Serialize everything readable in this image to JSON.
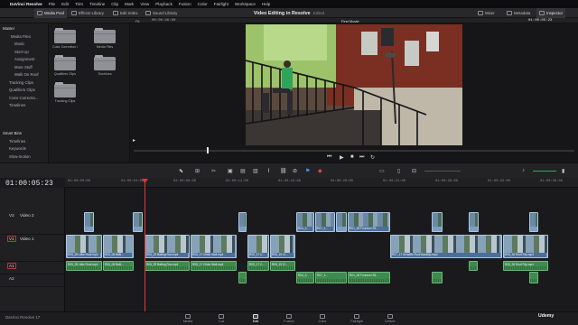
{
  "menubar": {
    "app": "DaVinci Resolve",
    "items": [
      "File",
      "Edit",
      "Trim",
      "Timeline",
      "Clip",
      "Mark",
      "View",
      "Playback",
      "Fusion",
      "Color",
      "Fairlight",
      "Workspace",
      "Help"
    ]
  },
  "toolbar": {
    "left": [
      "Media Pool",
      "Effects Library",
      "Edit Index",
      "Sound Library"
    ],
    "project_title": "Video Editing in Resolve",
    "project_state": "Edited",
    "right": [
      "Mixer",
      "Metadata",
      "Inspector"
    ]
  },
  "viewer": {
    "zoom": "Fit",
    "source_timecode": "00:00:36:00",
    "timeline_name": "First Movie",
    "record_timecode": "01:00:05:23"
  },
  "sidebar": {
    "master_label": "Master",
    "items": [
      {
        "label": "Media Files",
        "level": 1
      },
      {
        "label": "Music",
        "level": 2
      },
      {
        "label": "Stort Up",
        "level": 2
      },
      {
        "label": "Assignment",
        "level": 2
      },
      {
        "label": "More Stuff",
        "level": 2
      },
      {
        "label": "Walk On Roof",
        "level": 2
      },
      {
        "label": "Tracking Clips",
        "level": 1
      },
      {
        "label": "Qualifiers Clips",
        "level": 1
      },
      {
        "label": "Color Correctio...",
        "level": 1
      },
      {
        "label": "Timelines",
        "level": 1
      }
    ],
    "smart_bins_label": "Smart Bins",
    "smart_bins": [
      "Timelines",
      "Keywords",
      "Slow-motion"
    ]
  },
  "bins": [
    {
      "label": "Color Correction C..."
    },
    {
      "label": "Media Files"
    },
    {
      "label": "Qualifiers Clips"
    },
    {
      "label": "Timelines"
    },
    {
      "label": "Tracking Clips"
    }
  ],
  "timeline": {
    "timecode": "01:00:05:23",
    "ruler": [
      "01:00:00:00",
      "01:00:04:00",
      "01:00:08:00",
      "01:00:12:00",
      "01:00:16:00",
      "01:00:20:00",
      "01:00:24:00",
      "01:00:28:00",
      "01:00:32:00",
      "01:00:36:00"
    ],
    "tracks": [
      {
        "id": "V2",
        "name": "Video 2"
      },
      {
        "id": "V1",
        "name": "Video 1"
      },
      {
        "id": "A1",
        "name": ""
      },
      {
        "id": "A2",
        "name": ""
      }
    ],
    "v1_clips": [
      "R05_28 Little Roof.mp4",
      "R05_08 Balli...",
      "R05_29 Balling Run.mp4",
      "R05_17 Climb Wall.mp4",
      "R05_17 C...",
      "R05_19 Cl...",
      "R07_17 Growlife Roof Backflip.mp4",
      "R05_30 Roof Flip.mp4"
    ],
    "v2_clips": [
      "R04_2...",
      "R07_1...",
      "R01_28 Foursom Sli..."
    ],
    "a1_clips": [
      "R05_28 Little Roof.mp4",
      "R05_08 Balli...",
      "R05_29 Balling Run.mp4",
      "R05_17 Climb Wall.mp4",
      "R05_17 C...",
      "R05_19 Cl...",
      "R05_30 Roof Flip.mp4"
    ],
    "a2_clips": [
      "R04_2...",
      "R07_1...",
      "R01_28 Foursom Sli..."
    ]
  },
  "pages": [
    "Media",
    "Cut",
    "Edit",
    "Fusion",
    "Color",
    "Fairlight",
    "Deliver"
  ],
  "active_page": "Edit",
  "footer": {
    "app_version": "DaVinci Resolve 17",
    "watermark": "Udemy"
  }
}
